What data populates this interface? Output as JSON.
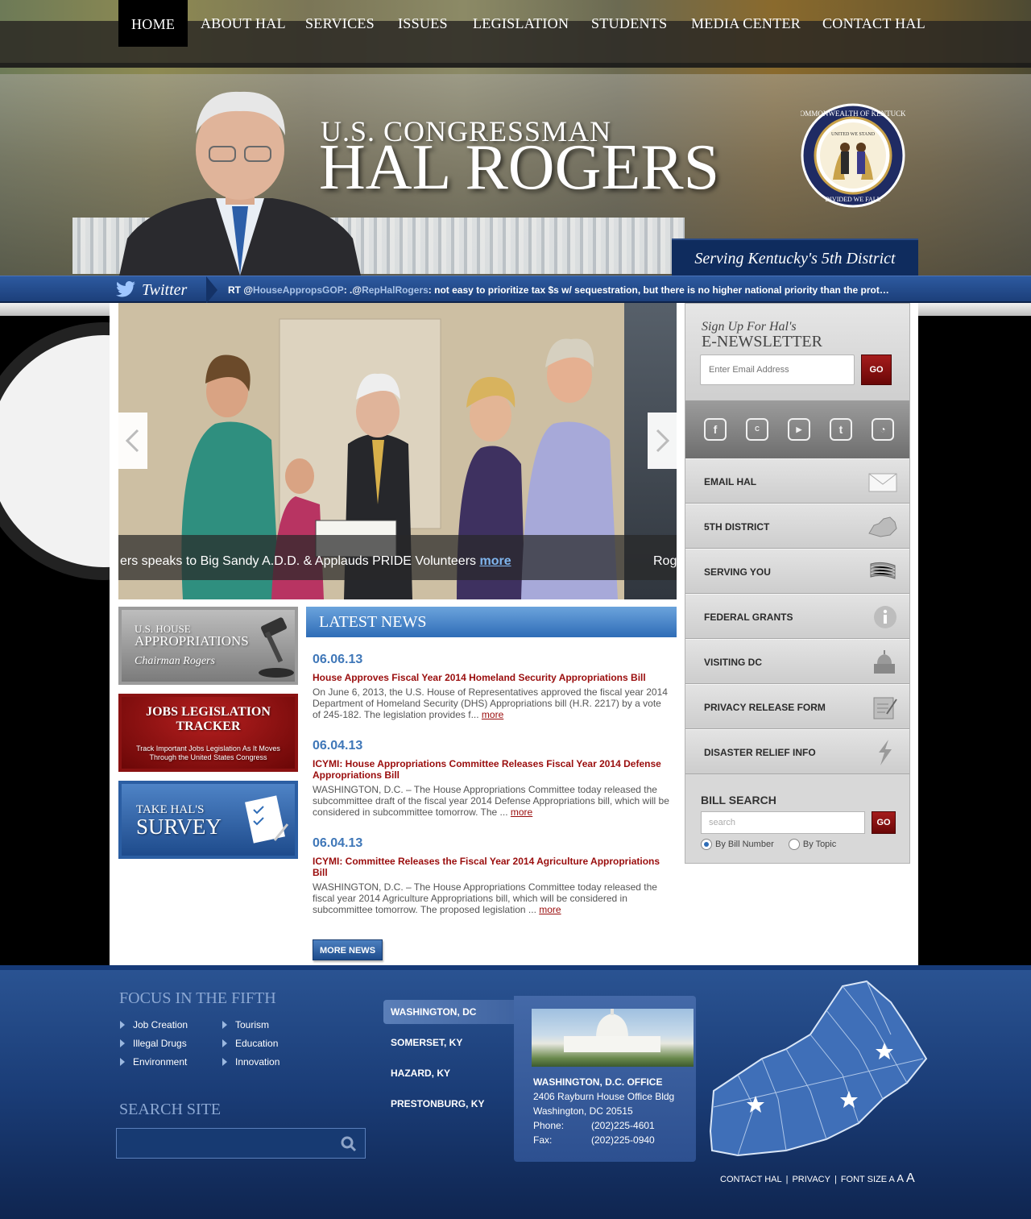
{
  "nav": {
    "items": [
      "HOME",
      "ABOUT HAL",
      "SERVICES",
      "ISSUES",
      "LEGISLATION",
      "STUDENTS",
      "MEDIA CENTER",
      "CONTACT HAL"
    ]
  },
  "header": {
    "title_small": "U.S. CONGRESSMAN",
    "title_big": "HAL ROGERS",
    "tagline": "Serving Kentucky's 5th District",
    "seal_text_top": "COMMONWEALTH OF KENTUCKY",
    "seal_text_bottom": "DIVIDED WE FALL",
    "seal_text_mid": "UNITED WE STAND"
  },
  "twitter": {
    "label": "Twitter",
    "tweet_prefix": "RT @",
    "tweet_handle1": "HouseAppropsGOP",
    "tweet_mid": ": .@",
    "tweet_handle2": "RepHalRogers",
    "tweet_text": ": not easy to prioritize tax $s w/ sequestration, but there is no higher national priority than the prot…"
  },
  "slider": {
    "caption": "ers speaks to Big Sandy A.D.D. & Applauds PRIDE Volunteers ",
    "more": "more",
    "next_caption": "Rog"
  },
  "banners": {
    "approp_1": "U.S. HOUSE",
    "approp_2": "APPROPRIATIONS",
    "approp_3": "Chairman Rogers",
    "jobs_1": "JOBS LEGISLATION",
    "jobs_2": "TRACKER",
    "jobs_3": "Track Important Jobs Legislation As It Moves",
    "jobs_4": "Through the United States Congress",
    "survey_1": "TAKE HAL'S",
    "survey_2": "SURVEY"
  },
  "news": {
    "heading": "LATEST NEWS",
    "items": [
      {
        "date": "06.06.13",
        "title": "House Approves Fiscal Year 2014 Homeland Security Appropriations Bill",
        "body": "On June 6, 2013, the U.S. House of Representatives approved the fiscal year 2014 Department of Homeland Security (DHS) Appropriations bill (H.R. 2217) by a vote of 245-182. The legislation provides f... ",
        "more": "more"
      },
      {
        "date": "06.04.13",
        "title": "ICYMI: House Appropriations Committee Releases Fiscal Year 2014 Defense Appropriations Bill",
        "body": "WASHINGTON, D.C. – The House Appropriations Committee today released the subcommittee draft of the fiscal year 2014 Defense Appropriations bill, which will be considered in subcommittee tomorrow. The ... ",
        "more": "more"
      },
      {
        "date": "06.04.13",
        "title": "ICYMI: Committee Releases the Fiscal Year 2014 Agriculture Appropriations Bill",
        "body": "WASHINGTON, D.C. – The House Appropriations Committee today released the fiscal year 2014 Agriculture Appropriations bill, which will be considered in subcommittee tomorrow. The proposed legislation ... ",
        "more": "more"
      }
    ],
    "more_news": "MORE NEWS"
  },
  "sidebar": {
    "enews_1": "Sign Up For Hal's",
    "enews_2": "E-NEWSLETTER",
    "enews_placeholder": "Enter Email Address",
    "go": "GO",
    "social": [
      "facebook-icon",
      "cspan-icon",
      "youtube-icon",
      "twitter-icon",
      "rss-icon"
    ],
    "links": [
      "EMAIL HAL",
      "5TH DISTRICT",
      "SERVING YOU",
      "FEDERAL GRANTS",
      "VISITING DC",
      "PRIVACY RELEASE FORM",
      "DISASTER RELIEF INFO"
    ],
    "bill_title": "BILL SEARCH",
    "bill_placeholder": "search",
    "radio_1": "By Bill Number",
    "radio_2": "By Topic"
  },
  "footer": {
    "focus_heading": "FOCUS IN THE FIFTH",
    "focus_links": [
      "Job Creation",
      "Tourism",
      "Illegal Drugs",
      "Education",
      "Environment",
      "Innovation"
    ],
    "search_heading": "SEARCH SITE",
    "offices": [
      "WASHINGTON, DC",
      "SOMERSET, KY",
      "HAZARD, KY",
      "PRESTONBURG, KY"
    ],
    "office_name": "WASHINGTON, D.C. OFFICE",
    "office_addr1": "2406 Rayburn House Office Bldg",
    "office_addr2": "Washington, DC 20515",
    "phone_label": "Phone:",
    "phone": "(202)225-4601",
    "fax_label": "Fax:",
    "fax": "(202)225-0940",
    "links": {
      "contact": "CONTACT HAL",
      "privacy": "PRIVACY",
      "font": "FONT SIZE",
      "a_small": "A",
      "a_mid": "A",
      "a_big": "A"
    }
  },
  "colors": {
    "accent": "#9a0d0d",
    "blue": "#2f6db7",
    "navy": "#0f2c5e"
  }
}
